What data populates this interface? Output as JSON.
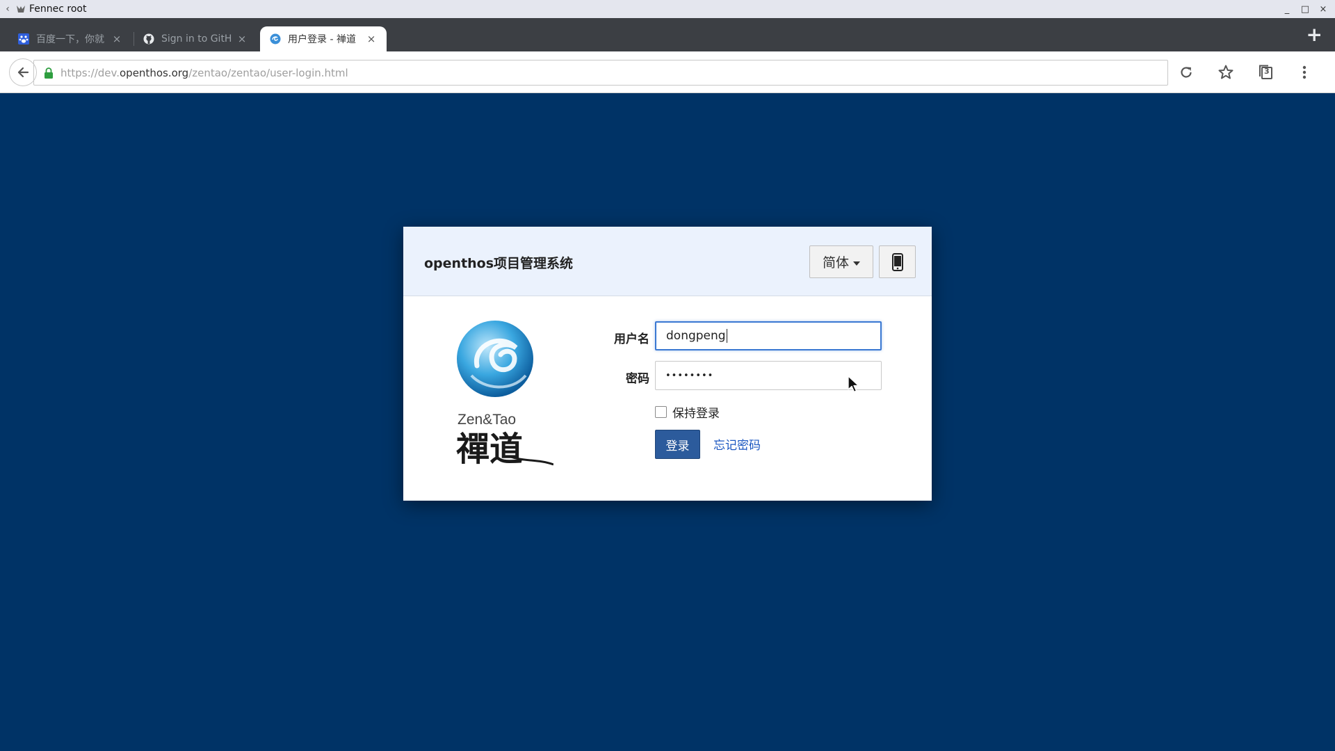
{
  "window": {
    "title": "Fennec root",
    "minimize": "_",
    "maximize": "□",
    "close": "×"
  },
  "tabs": [
    {
      "label": "百度一下，你就",
      "icon": "baidu-favicon",
      "close": "×"
    },
    {
      "label": "Sign in to GitH",
      "icon": "github-favicon",
      "close": "×"
    },
    {
      "label": "用户登录 - 禅道",
      "icon": "zentao-favicon",
      "close": "×",
      "active": true
    }
  ],
  "new_tab": "+",
  "toolbar": {
    "url_scheme": "https://dev.",
    "url_host": "openthos.org",
    "url_path": "/zentao/zentao/user-login.html",
    "tab_count": "3"
  },
  "login": {
    "system_title": "openthos项目管理系统",
    "language": "简体",
    "logo_text_en": "Zen&Tao",
    "logo_text_cn": "禪道",
    "username_label": "用户名",
    "username_value": "dongpeng",
    "password_label": "密码",
    "password_value": "••••••••",
    "keep_login": "保持登录",
    "login_button": "登录",
    "forgot_password": "忘记密码"
  },
  "colors": {
    "page_bg": "#003366",
    "accent": "#2c5b9c",
    "link": "#1a56c0"
  }
}
